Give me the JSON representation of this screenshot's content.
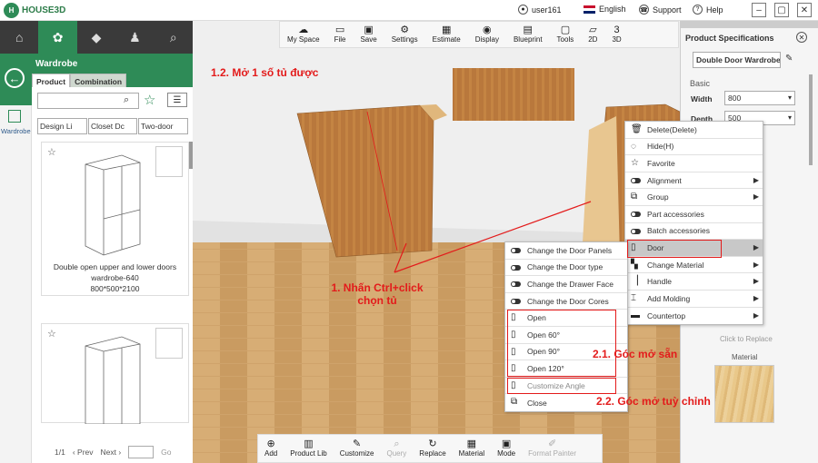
{
  "app": {
    "logo_text": "HOUSE3D",
    "logo_mark": "H"
  },
  "topbar": {
    "user": "user161",
    "language": "English",
    "support": "Support",
    "help": "Help"
  },
  "left_nav": {
    "tabs": [
      "⌂",
      "✿",
      "◆",
      "♟",
      "⌕"
    ]
  },
  "panel": {
    "title": "Wardrobe",
    "subtabs": [
      "Product",
      "Combination"
    ],
    "side_label": "Wardrobe",
    "filters": [
      "Design Li",
      "Closet Dc",
      "Two-door"
    ],
    "card1_name_line1": "Double open upper and lower doors",
    "card1_name_line2": "wardrobe-640",
    "card1_dims": "800*500*2100",
    "pager": {
      "pages": "1/1",
      "prev": "‹ Prev",
      "next": "Next ›",
      "go": "Go"
    }
  },
  "toolbar": [
    {
      "icon": "☁",
      "label": "My Space"
    },
    {
      "icon": "▭",
      "label": "File"
    },
    {
      "icon": "▣",
      "label": "Save"
    },
    {
      "icon": "⚙",
      "label": "Settings"
    },
    {
      "icon": "▦",
      "label": "Estimate"
    },
    {
      "icon": "◉",
      "label": "Display"
    },
    {
      "icon": "▤",
      "label": "Blueprint"
    },
    {
      "icon": "▢",
      "label": "Tools"
    },
    {
      "icon": "▱",
      "label": "2D"
    },
    {
      "icon": "3",
      "label": "3D"
    }
  ],
  "bottombar": [
    {
      "icon": "⊕",
      "label": "Add",
      "enabled": true
    },
    {
      "icon": "▥",
      "label": "Product Lib",
      "enabled": true
    },
    {
      "icon": "✎",
      "label": "Customize",
      "enabled": true
    },
    {
      "icon": "⌕",
      "label": "Query",
      "enabled": false
    },
    {
      "icon": "↻",
      "label": "Replace",
      "enabled": true
    },
    {
      "icon": "▦",
      "label": "Material",
      "enabled": true
    },
    {
      "icon": "▣",
      "label": "Mode",
      "enabled": true
    },
    {
      "icon": "✐",
      "label": "Format Painter",
      "enabled": false
    }
  ],
  "right_panel": {
    "title": "Product Specifications",
    "product_name": "Double Door Wardrobe",
    "section": "Basic",
    "width_label": "Width",
    "width_value": "800",
    "depth_label": "Depth",
    "depth_value": "500",
    "click_to_replace": "Click to Replace",
    "material_label": "Material"
  },
  "context_menu": {
    "items": [
      {
        "icon": "trash-icon",
        "label": "Delete(Delete)"
      },
      {
        "icon": "eye-off-icon",
        "label": "Hide(H)"
      },
      {
        "icon": "star-icon",
        "label": "Favorite"
      },
      {
        "icon": "toggle-icon",
        "label": "Alignment",
        "submenu": true
      },
      {
        "icon": "group-icon",
        "label": "Group",
        "submenu": true
      },
      {
        "icon": "toggle-icon",
        "label": "Part accessories"
      },
      {
        "icon": "toggle-icon",
        "label": "Batch accessories"
      },
      {
        "icon": "door-icon",
        "label": "Door",
        "submenu": true,
        "highlighted": true
      },
      {
        "icon": "checker-icon",
        "label": "Change Material",
        "submenu": true
      },
      {
        "icon": "handle-icon",
        "label": "Handle",
        "submenu": true
      },
      {
        "icon": "molding-icon",
        "label": "Add Molding",
        "submenu": true
      },
      {
        "icon": "countertop-icon",
        "label": "Countertop",
        "submenu": true
      }
    ]
  },
  "door_submenu": {
    "items": [
      {
        "label": "Change the Door Panels"
      },
      {
        "label": "Change the Door type"
      },
      {
        "label": "Change the Drawer Face"
      },
      {
        "label": "Change the Door Cores"
      },
      {
        "label": "Open"
      },
      {
        "label": "Open 60°"
      },
      {
        "label": "Open 90°"
      },
      {
        "label": "Open 120°"
      },
      {
        "label": "Customize Angle"
      },
      {
        "label": "Close"
      }
    ]
  },
  "annotations": {
    "step_open": "1.2. Mở 1 số tủ được",
    "step_ctrl_line1": "1. Nhấn Ctrl+click",
    "step_ctrl_line2": "chọn tủ",
    "preset_angle": "2.1. Góc mở sẵn",
    "custom_angle": "2.2. Góc mở tuỳ chỉnh"
  },
  "colors": {
    "brand": "#2e8b57",
    "annotation": "#e31b1b",
    "wood": "#b8783a"
  }
}
